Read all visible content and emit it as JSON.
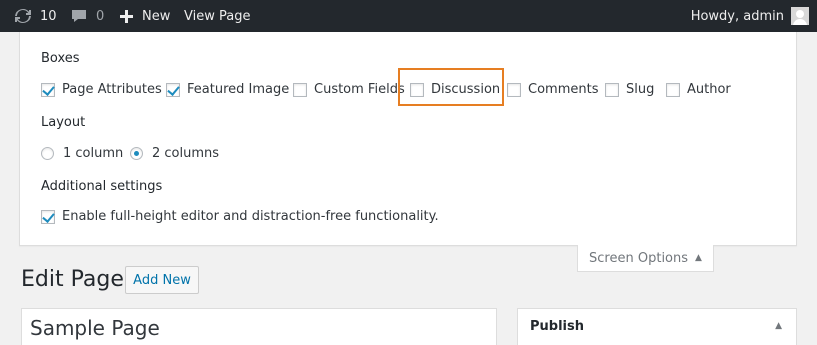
{
  "adminbar": {
    "updates_count": "10",
    "comments_count": "0",
    "new_label": "New",
    "view_page_label": "View Page",
    "howdy_label": "Howdy, admin"
  },
  "screen_options": {
    "boxes_title": "Boxes",
    "boxes": [
      {
        "label": "Page Attributes",
        "checked": true
      },
      {
        "label": "Featured Image",
        "checked": true
      },
      {
        "label": "Custom Fields",
        "checked": false
      },
      {
        "label": "Discussion",
        "checked": false
      },
      {
        "label": "Comments",
        "checked": false
      },
      {
        "label": "Slug",
        "checked": false
      },
      {
        "label": "Author",
        "checked": false
      }
    ],
    "layout_title": "Layout",
    "layout_options": [
      {
        "label": "1 column",
        "checked": false
      },
      {
        "label": "2 columns",
        "checked": true
      }
    ],
    "additional_title": "Additional settings",
    "additional_option": {
      "label": "Enable full-height editor and distraction-free functionality.",
      "checked": true
    },
    "tab_label": "Screen Options",
    "highlight_color": "#e67e22"
  },
  "edit": {
    "title": "Edit Page",
    "add_new_label": "Add New",
    "post_title_value": "Sample Page",
    "publish_label": "Publish"
  }
}
